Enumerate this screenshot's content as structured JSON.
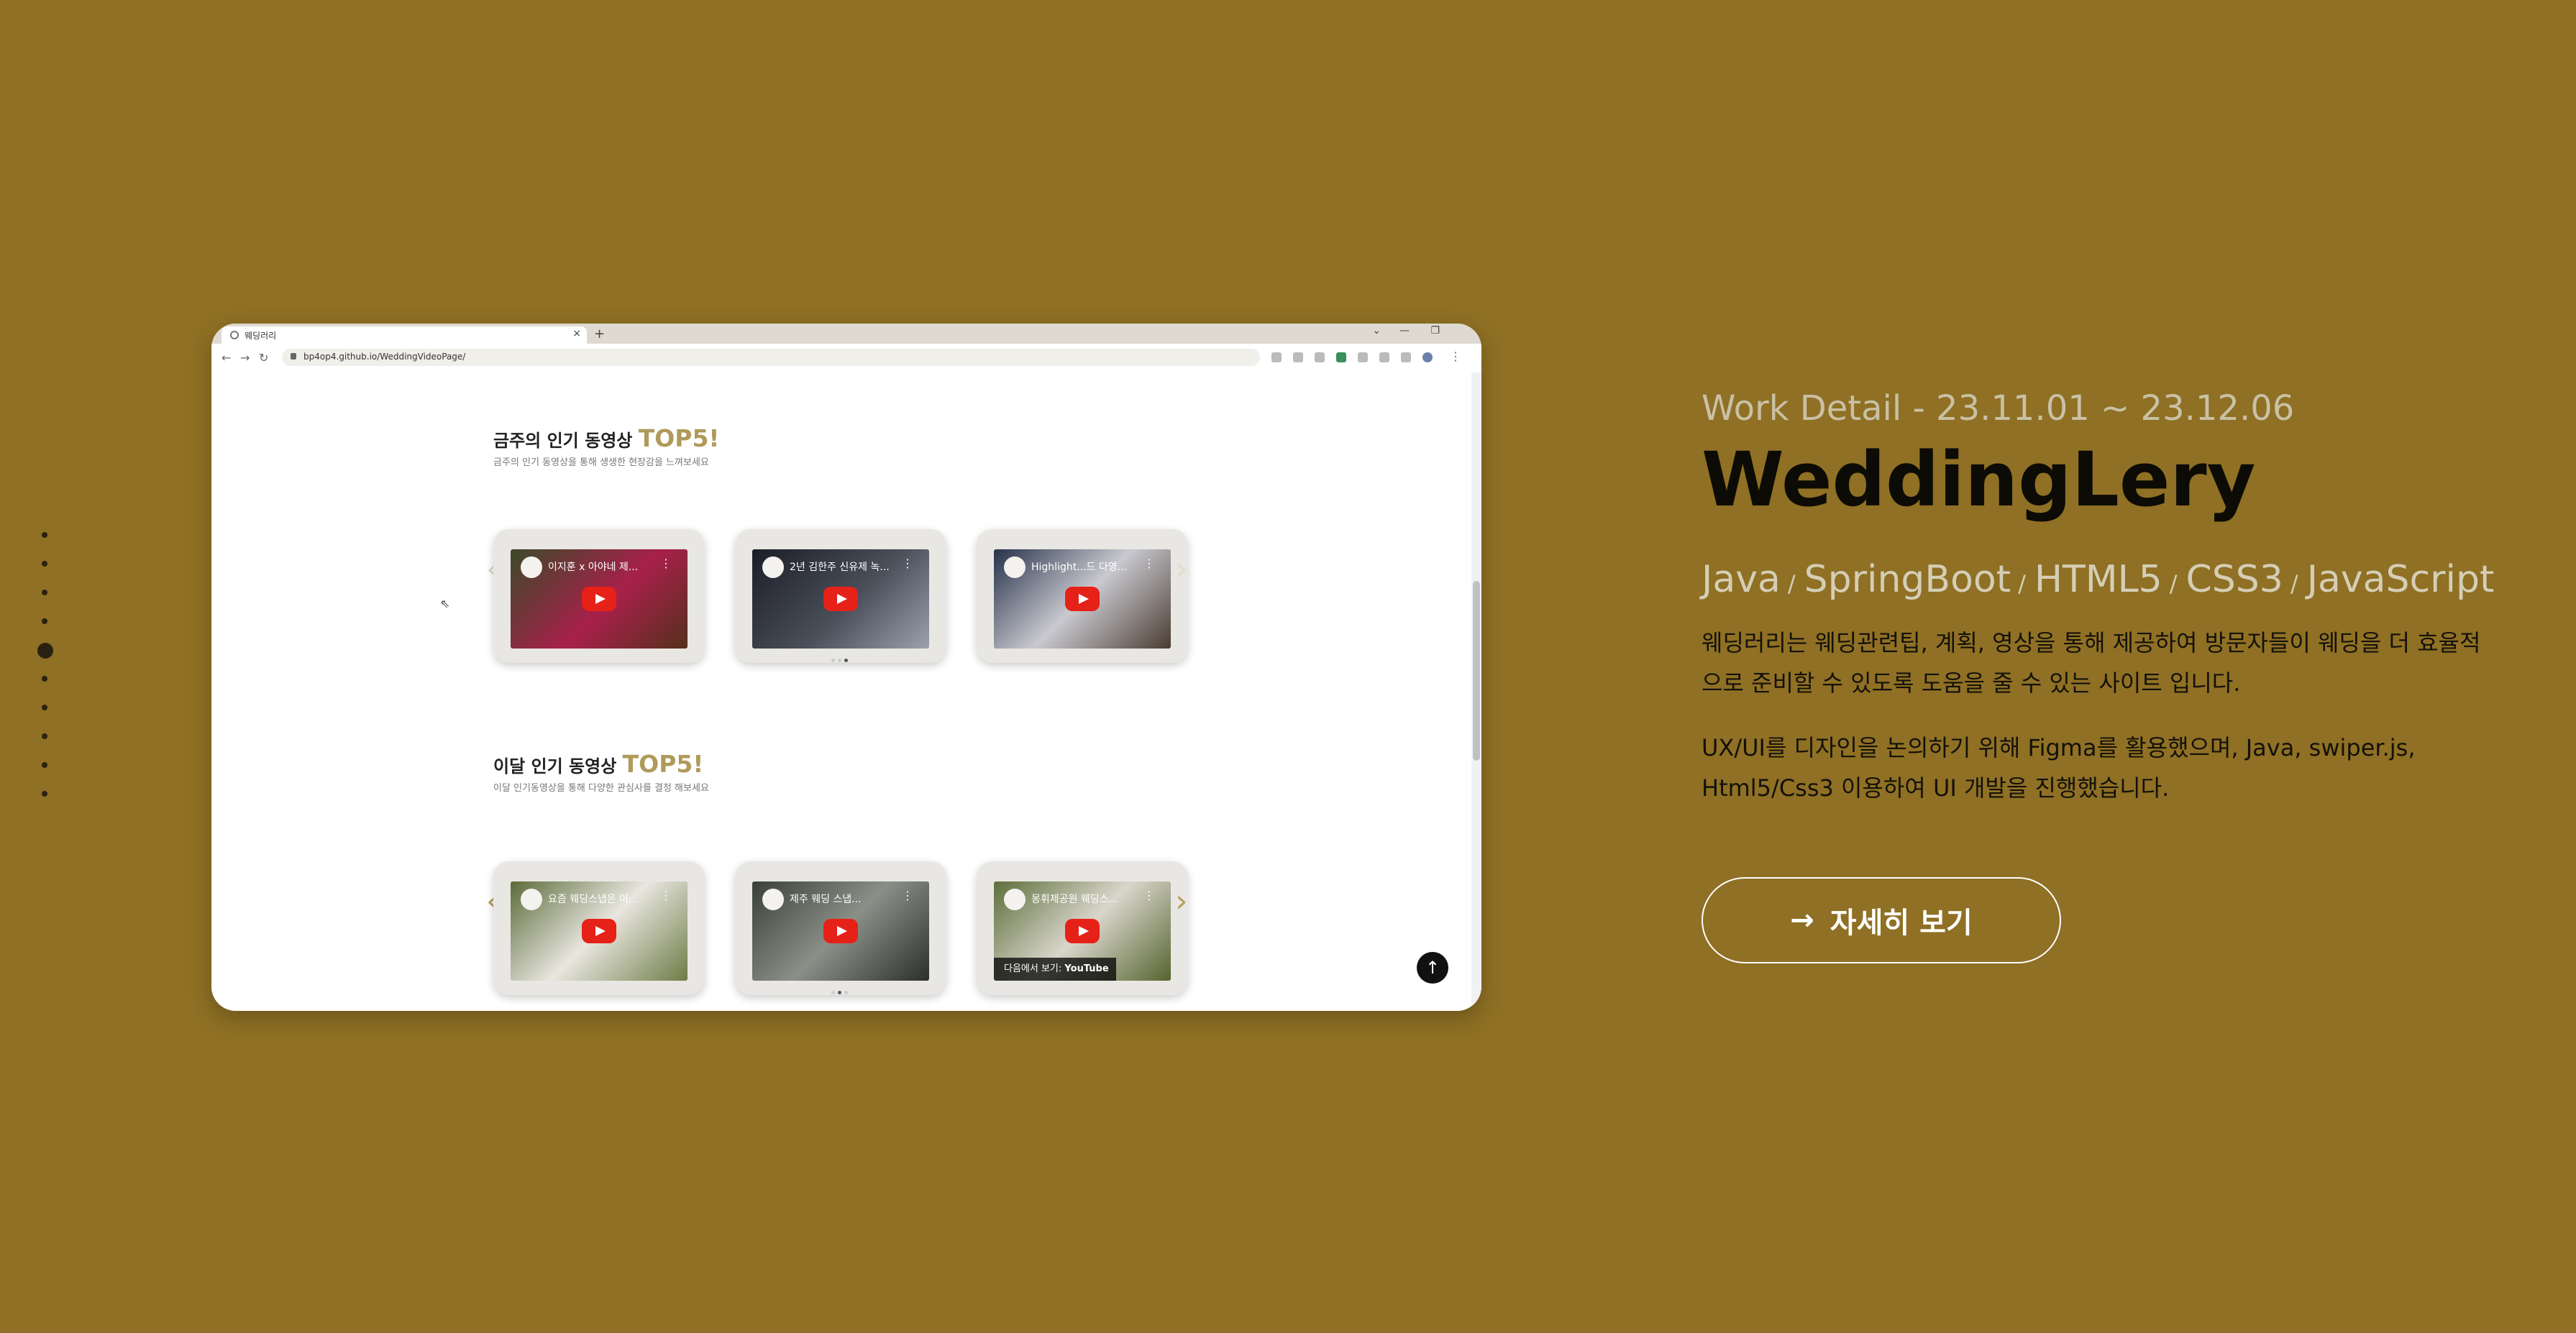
{
  "colors": {
    "background": "#8f7024",
    "accent": "#b09a5a",
    "button_border": "#ffffff"
  },
  "dot_nav": {
    "count": 10,
    "active_index": 4
  },
  "browser": {
    "tab_title": "웨딩러리",
    "tab_close": "×",
    "new_tab": "+",
    "url": "bp4op4.github.io/WeddingVideoPage/",
    "window_controls": [
      "⌄",
      "—",
      "❐"
    ]
  },
  "sections": [
    {
      "title": "금주의 인기 동영상",
      "title_accent": "TOP5!",
      "subtitle": "금주의 인기 동영상을 통해 생생한 현장감을 느껴보세요",
      "videos": [
        {
          "title": "이지훈 x 아야네 제..."
        },
        {
          "title": "2년 김한주 신유제 녹..."
        },
        {
          "title": "Highlight...드 다영..."
        }
      ],
      "pager_active": 2
    },
    {
      "title": "이달 인기 동영상",
      "title_accent": "TOP5!",
      "subtitle": "이달 인기동영상을 통해 다양한 관심사를 결정 해보세요",
      "videos": [
        {
          "title": "요즘 웨딩스냅은 이..."
        },
        {
          "title": "제주 웨딩 스냅..."
        },
        {
          "title": "몽휘제공원 웨딩스..."
        }
      ],
      "watch_on": "다음에서 보기:",
      "watch_brand": "YouTube",
      "pager_active": 1
    }
  ],
  "info": {
    "work_detail": "Work Detail - 23.11.01 ~ 23.12.06",
    "project_title": "WeddingLery",
    "tech_stack": [
      "Java",
      "SpringBoot",
      "HTML5",
      "CSS3",
      "JavaScript"
    ],
    "tech_separator": "/",
    "description_1": "웨딩러리는 웨딩관련팁, 계획, 영상을 통해 제공하여 방문자들이 웨딩을 더 효율적으로 준비할 수 있도록 도움을 줄 수 있는 사이트 입니다.",
    "description_2": "UX/UI를 디자인을 논의하기 위해 Figma를 활용했으며, Java, swiper.js, Html5/Css3 이용하여 UI 개발을 진행했습니다.",
    "button_arrow": "→",
    "button_label": "자세히 보기"
  }
}
